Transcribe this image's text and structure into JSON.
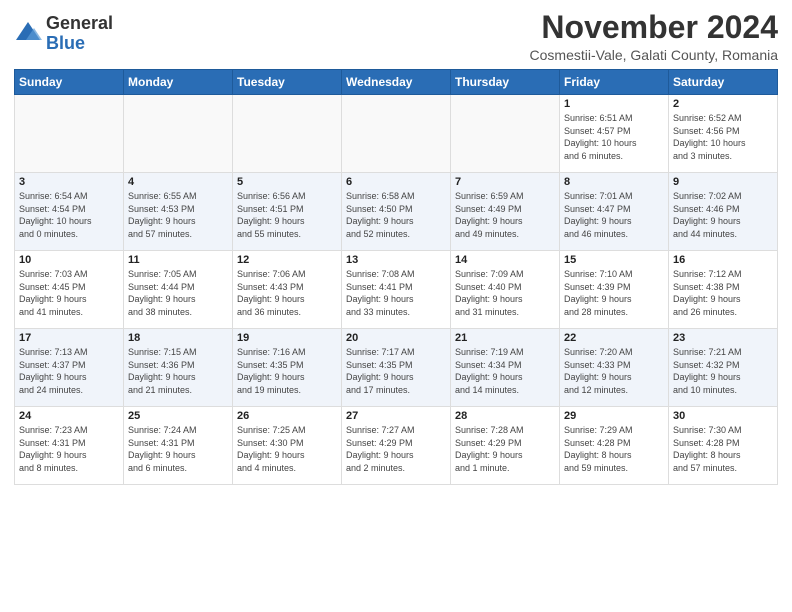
{
  "header": {
    "logo_line1": "General",
    "logo_line2": "Blue",
    "month_title": "November 2024",
    "subtitle": "Cosmestii-Vale, Galati County, Romania"
  },
  "weekdays": [
    "Sunday",
    "Monday",
    "Tuesday",
    "Wednesday",
    "Thursday",
    "Friday",
    "Saturday"
  ],
  "weeks": [
    [
      {
        "day": "",
        "detail": ""
      },
      {
        "day": "",
        "detail": ""
      },
      {
        "day": "",
        "detail": ""
      },
      {
        "day": "",
        "detail": ""
      },
      {
        "day": "",
        "detail": ""
      },
      {
        "day": "1",
        "detail": "Sunrise: 6:51 AM\nSunset: 4:57 PM\nDaylight: 10 hours\nand 6 minutes."
      },
      {
        "day": "2",
        "detail": "Sunrise: 6:52 AM\nSunset: 4:56 PM\nDaylight: 10 hours\nand 3 minutes."
      }
    ],
    [
      {
        "day": "3",
        "detail": "Sunrise: 6:54 AM\nSunset: 4:54 PM\nDaylight: 10 hours\nand 0 minutes."
      },
      {
        "day": "4",
        "detail": "Sunrise: 6:55 AM\nSunset: 4:53 PM\nDaylight: 9 hours\nand 57 minutes."
      },
      {
        "day": "5",
        "detail": "Sunrise: 6:56 AM\nSunset: 4:51 PM\nDaylight: 9 hours\nand 55 minutes."
      },
      {
        "day": "6",
        "detail": "Sunrise: 6:58 AM\nSunset: 4:50 PM\nDaylight: 9 hours\nand 52 minutes."
      },
      {
        "day": "7",
        "detail": "Sunrise: 6:59 AM\nSunset: 4:49 PM\nDaylight: 9 hours\nand 49 minutes."
      },
      {
        "day": "8",
        "detail": "Sunrise: 7:01 AM\nSunset: 4:47 PM\nDaylight: 9 hours\nand 46 minutes."
      },
      {
        "day": "9",
        "detail": "Sunrise: 7:02 AM\nSunset: 4:46 PM\nDaylight: 9 hours\nand 44 minutes."
      }
    ],
    [
      {
        "day": "10",
        "detail": "Sunrise: 7:03 AM\nSunset: 4:45 PM\nDaylight: 9 hours\nand 41 minutes."
      },
      {
        "day": "11",
        "detail": "Sunrise: 7:05 AM\nSunset: 4:44 PM\nDaylight: 9 hours\nand 38 minutes."
      },
      {
        "day": "12",
        "detail": "Sunrise: 7:06 AM\nSunset: 4:43 PM\nDaylight: 9 hours\nand 36 minutes."
      },
      {
        "day": "13",
        "detail": "Sunrise: 7:08 AM\nSunset: 4:41 PM\nDaylight: 9 hours\nand 33 minutes."
      },
      {
        "day": "14",
        "detail": "Sunrise: 7:09 AM\nSunset: 4:40 PM\nDaylight: 9 hours\nand 31 minutes."
      },
      {
        "day": "15",
        "detail": "Sunrise: 7:10 AM\nSunset: 4:39 PM\nDaylight: 9 hours\nand 28 minutes."
      },
      {
        "day": "16",
        "detail": "Sunrise: 7:12 AM\nSunset: 4:38 PM\nDaylight: 9 hours\nand 26 minutes."
      }
    ],
    [
      {
        "day": "17",
        "detail": "Sunrise: 7:13 AM\nSunset: 4:37 PM\nDaylight: 9 hours\nand 24 minutes."
      },
      {
        "day": "18",
        "detail": "Sunrise: 7:15 AM\nSunset: 4:36 PM\nDaylight: 9 hours\nand 21 minutes."
      },
      {
        "day": "19",
        "detail": "Sunrise: 7:16 AM\nSunset: 4:35 PM\nDaylight: 9 hours\nand 19 minutes."
      },
      {
        "day": "20",
        "detail": "Sunrise: 7:17 AM\nSunset: 4:35 PM\nDaylight: 9 hours\nand 17 minutes."
      },
      {
        "day": "21",
        "detail": "Sunrise: 7:19 AM\nSunset: 4:34 PM\nDaylight: 9 hours\nand 14 minutes."
      },
      {
        "day": "22",
        "detail": "Sunrise: 7:20 AM\nSunset: 4:33 PM\nDaylight: 9 hours\nand 12 minutes."
      },
      {
        "day": "23",
        "detail": "Sunrise: 7:21 AM\nSunset: 4:32 PM\nDaylight: 9 hours\nand 10 minutes."
      }
    ],
    [
      {
        "day": "24",
        "detail": "Sunrise: 7:23 AM\nSunset: 4:31 PM\nDaylight: 9 hours\nand 8 minutes."
      },
      {
        "day": "25",
        "detail": "Sunrise: 7:24 AM\nSunset: 4:31 PM\nDaylight: 9 hours\nand 6 minutes."
      },
      {
        "day": "26",
        "detail": "Sunrise: 7:25 AM\nSunset: 4:30 PM\nDaylight: 9 hours\nand 4 minutes."
      },
      {
        "day": "27",
        "detail": "Sunrise: 7:27 AM\nSunset: 4:29 PM\nDaylight: 9 hours\nand 2 minutes."
      },
      {
        "day": "28",
        "detail": "Sunrise: 7:28 AM\nSunset: 4:29 PM\nDaylight: 9 hours\nand 1 minute."
      },
      {
        "day": "29",
        "detail": "Sunrise: 7:29 AM\nSunset: 4:28 PM\nDaylight: 8 hours\nand 59 minutes."
      },
      {
        "day": "30",
        "detail": "Sunrise: 7:30 AM\nSunset: 4:28 PM\nDaylight: 8 hours\nand 57 minutes."
      }
    ]
  ]
}
